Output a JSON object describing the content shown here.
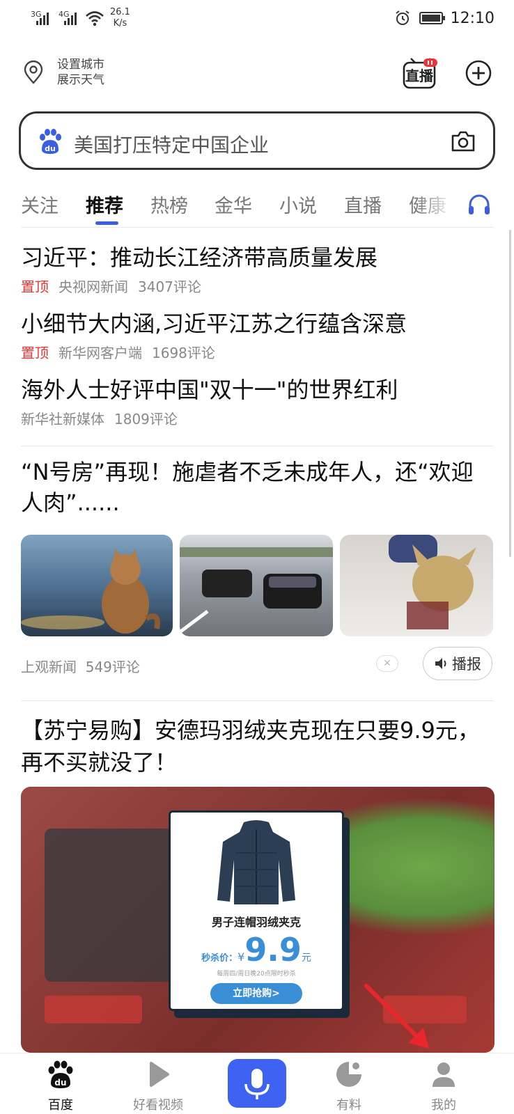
{
  "status_bar": {
    "signal1": "3G",
    "signal2": "4G",
    "speed_value": "26.1",
    "speed_unit": "K/s",
    "time": "12:10"
  },
  "header": {
    "weather_line1": "设置城市",
    "weather_line2": "展示天气",
    "live_label": "直播"
  },
  "search": {
    "placeholder": "美国打压特定中国企业"
  },
  "tabs": [
    "关注",
    "推荐",
    "热榜",
    "金华",
    "小说",
    "直播",
    "健康"
  ],
  "active_tab": "推荐",
  "news": [
    {
      "title": "习近平：推动长江经济带高质量发展",
      "pin": "置顶",
      "source": "央视网新闻",
      "comments": "3407评论"
    },
    {
      "title": "小细节大内涵,习近平江苏之行蕴含深意",
      "pin": "置顶",
      "source": "新华网客户端",
      "comments": "1698评论"
    },
    {
      "title": "海外人士好评中国\"双十一\"的世界红利",
      "pin": "",
      "source": "新华社新媒体",
      "comments": "1809评论"
    }
  ],
  "image_article": {
    "title": "“N号房”再现！施虐者不乏未成年人，还“欢迎人肉”......",
    "source": "上观新闻",
    "comments": "549评论",
    "play_label": "播报"
  },
  "ad": {
    "title": "【苏宁易购】安德玛羽绒夹克现在只要9.9元，再不买就没了！",
    "product": "男子连帽羽绒夹克",
    "price_label": "秒杀价：",
    "currency": "¥",
    "price": "9.9",
    "unit": "元",
    "note": "每周四/周日晚20点限时秒杀",
    "cta": "立即抢购>"
  },
  "bottom_nav": {
    "home": "百度",
    "video": "好看视频",
    "youliao": "有料",
    "mine": "我的"
  },
  "colors": {
    "accent": "#3e62f2",
    "pin": "#e33333",
    "tab_underline": "#3a5fe6"
  }
}
